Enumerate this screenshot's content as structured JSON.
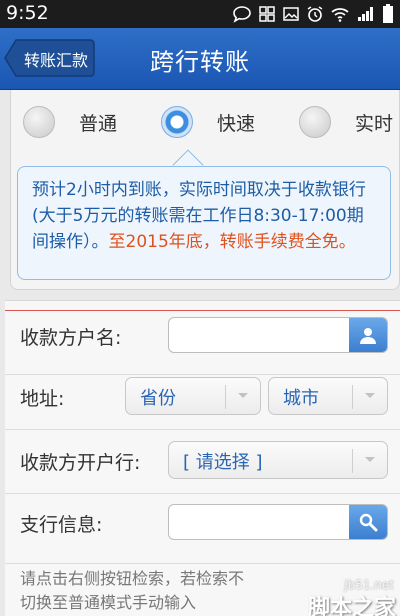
{
  "status_bar": {
    "time": "9:52"
  },
  "nav": {
    "back_label": "转账汇款",
    "title": "跨行转账"
  },
  "transfer_modes": [
    {
      "label": "普通",
      "selected": false
    },
    {
      "label": "快速",
      "selected": true
    },
    {
      "label": "实时",
      "selected": false
    }
  ],
  "tip": {
    "normal": "预计2小时内到账，实际时间取决于收款银行(大于5万元的转账需在工作日8:30-17:00期间操作）。",
    "highlight": "至2015年底，转账手续费全免。"
  },
  "form": {
    "payee_name_label": "收款方户名:",
    "payee_name_value": "",
    "address_label": "地址:",
    "province_select": "省份",
    "city_select": "城市",
    "bank_label": "收款方开户行:",
    "bank_select": "[ 请选择 ]",
    "branch_label": "支行信息:",
    "branch_value": "",
    "hint_line1": "请点击右侧按钮检索，若检索不",
    "hint_line2": "切换至普通模式手动输入"
  },
  "watermark": {
    "site": "jb51.net",
    "text": "脚本之家"
  },
  "colors": {
    "nav_blue": "#1a56b2",
    "link_blue": "#2a65b4",
    "highlight_orange": "#e0521d",
    "divider_red": "#d9534f"
  }
}
